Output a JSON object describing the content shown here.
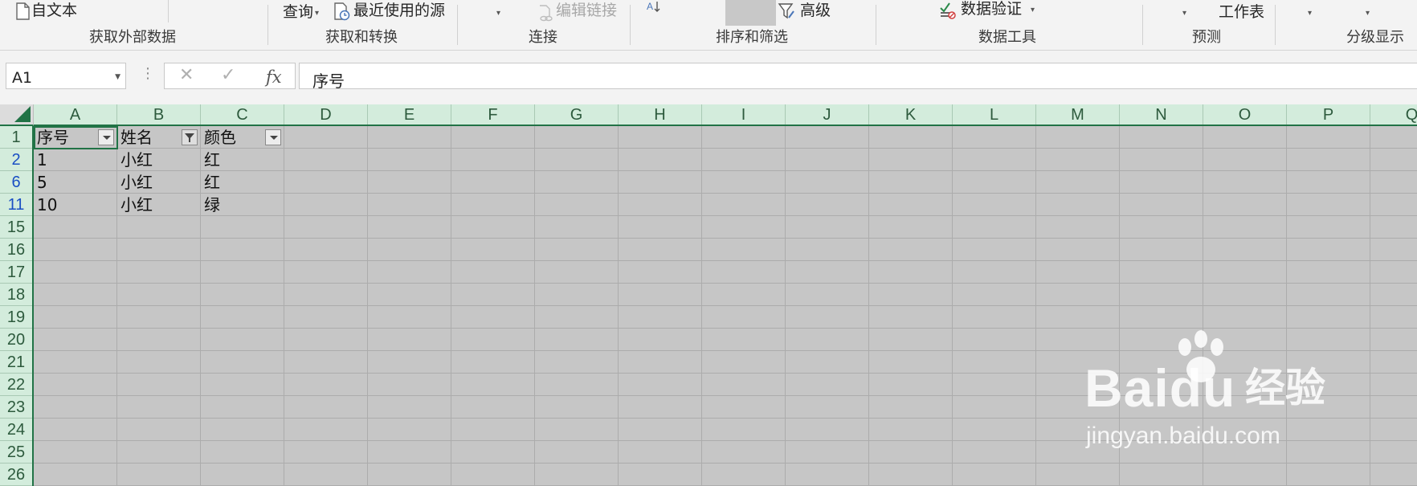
{
  "ribbon": {
    "from_text": "自文本",
    "query_a": "查询",
    "recent_sources": "最近使用的源",
    "edit_links": "编辑链接",
    "advanced": "高级",
    "data_validation": "数据验证",
    "worksheet": "工作表",
    "groups": {
      "get_external_data": "获取外部数据",
      "get_transform": "获取和转换",
      "connections": "连接",
      "sort_filter": "排序和筛选",
      "data_tools": "数据工具",
      "forecast": "预测",
      "outline": "分级显示"
    }
  },
  "formula_bar": {
    "name_box": "A1",
    "fx": "fx",
    "content": "序号"
  },
  "columns": [
    "A",
    "B",
    "C",
    "D",
    "E",
    "F",
    "G",
    "H",
    "I",
    "J",
    "K",
    "L",
    "M",
    "N",
    "O",
    "P",
    "Q"
  ],
  "rows": [
    "1",
    "2",
    "6",
    "11",
    "15",
    "16",
    "17",
    "18",
    "19",
    "20",
    "21",
    "22",
    "23",
    "24",
    "25",
    "26"
  ],
  "table": {
    "headers": [
      "序号",
      "姓名",
      "颜色"
    ],
    "data": [
      [
        "1",
        "小红",
        "红"
      ],
      [
        "5",
        "小红",
        "红"
      ],
      [
        "10",
        "小红",
        "绿"
      ]
    ]
  },
  "watermark": {
    "brand": "Bai",
    "brand_tail": "du",
    "cn": "经验",
    "url": "jingyan.baidu.com"
  },
  "colors": {
    "accent": "#217346",
    "header_bg": "#d3ecdc",
    "grid_bg": "#c6c6c6",
    "filtered_row": "#1a4fc4"
  }
}
